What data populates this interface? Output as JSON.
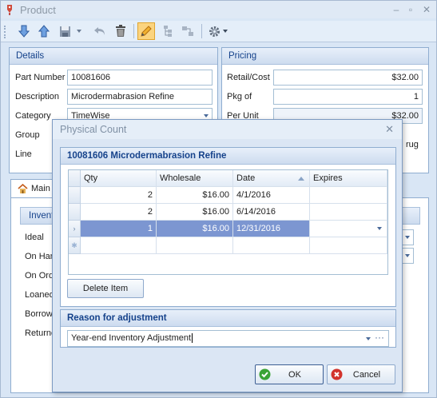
{
  "window": {
    "title": "Product"
  },
  "toolbar": {
    "buttons": [
      {
        "icon": "arrow-down-icon"
      },
      {
        "icon": "arrow-up-icon"
      },
      {
        "icon": "save-icon"
      },
      {
        "icon": "undo-icon"
      },
      {
        "icon": "trash-icon"
      },
      {
        "icon": "pencil-icon"
      },
      {
        "icon": "tree-icon"
      },
      {
        "icon": "link-icon"
      },
      {
        "icon": "gear-icon"
      }
    ]
  },
  "details": {
    "title": "Details",
    "part_number_label": "Part Number",
    "part_number": "10081606",
    "description_label": "Description",
    "description": "Microdermabrasion Refine",
    "category_label": "Category",
    "category": "TimeWise",
    "group_label": "Group",
    "line_label": "Line"
  },
  "pricing": {
    "title": "Pricing",
    "retail_cost_label": "Retail/Cost",
    "retail_cost": "$32.00",
    "pkg_of_label": "Pkg of",
    "pkg_of": "1",
    "per_unit_label": "Per Unit",
    "per_unit": "$32.00",
    "partial_label": "rug"
  },
  "tabs": {
    "main": "Main",
    "inventory_partial": "Invent"
  },
  "inventory_labels": [
    "Ideal",
    "On Han",
    "On Ord",
    "Loaned",
    "Borrow",
    "Returne"
  ],
  "dialog": {
    "title": "Physical Count",
    "item_header": "10081606 Microdermabrasion Refine",
    "columns": [
      "Qty",
      "Wholesale",
      "Date",
      "Expires"
    ],
    "rows": [
      {
        "qty": "2",
        "wholesale": "$16.00",
        "date": "4/1/2016",
        "expires": ""
      },
      {
        "qty": "2",
        "wholesale": "$16.00",
        "date": "6/14/2016",
        "expires": ""
      },
      {
        "qty": "1",
        "wholesale": "$16.00",
        "date": "12/31/2016",
        "expires": ""
      }
    ],
    "delete_button": "Delete Item",
    "reason_header": "Reason for adjustment",
    "reason_value": "Year-end Inventory Adjustment",
    "ok_button": "OK",
    "cancel_button": "Cancel"
  },
  "colors": {
    "accent": "#15428b",
    "selection": "#7c96d1",
    "ok": "#3aa335",
    "cancel": "#d2332c"
  }
}
